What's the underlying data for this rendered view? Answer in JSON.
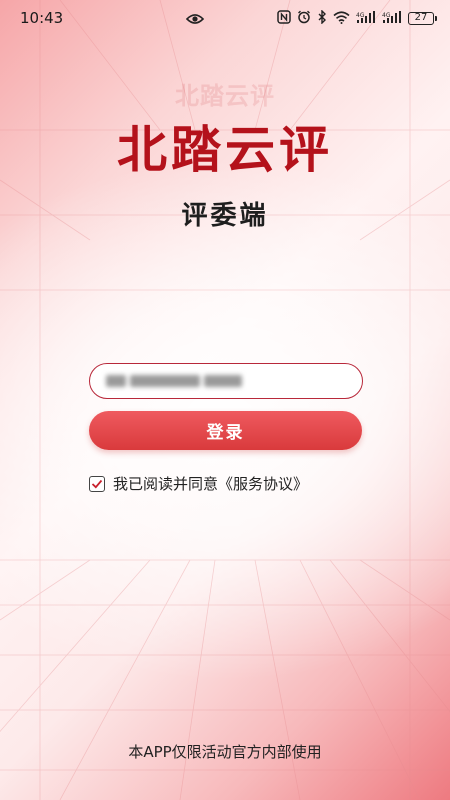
{
  "status_bar": {
    "time": "10:43",
    "battery": "27",
    "icons": [
      "eye-icon",
      "nfc-icon",
      "alarm-icon",
      "bluetooth-icon",
      "wifi-icon",
      "signal-4g-icon",
      "signal-4g-icon"
    ]
  },
  "header": {
    "watermark": "北踏云评",
    "title": "北踏云评",
    "subtitle": "评委端"
  },
  "login": {
    "phone_value": "",
    "button_label": "登录"
  },
  "agreement": {
    "checked": true,
    "text": "我已阅读并同意",
    "link": "《服务协议》"
  },
  "footer": {
    "note": "本APP仅限活动官方内部使用"
  },
  "colors": {
    "title": "#b4121b",
    "button": "#e04648",
    "input_border": "#b8283a"
  }
}
